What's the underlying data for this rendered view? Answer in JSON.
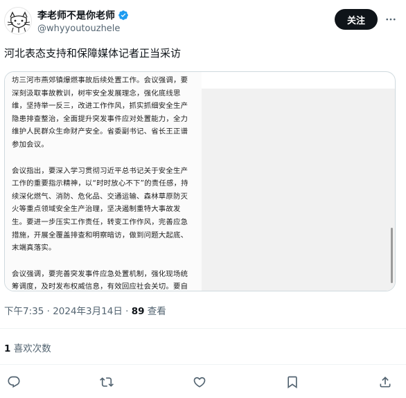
{
  "author": {
    "name": "李老师不是你老师",
    "handle": "@whyyoutouzhele",
    "verified": true,
    "avatar_icon": "doodle-cat-avatar"
  },
  "header": {
    "follow_label": "关注",
    "more_icon": "more-dots-icon"
  },
  "tweet": {
    "text": "河北表态支持和保障媒体记者正当采访",
    "image_paragraphs": [
      "坊三河市燕郊镇爆燃事故后续处置工作。会议强调，要深刻汲取事故教训，树牢安全发展理念，强化底线思维，坚持举一反三，改进工作作风，抓实抓细安全生产隐患排查整治，全面提升突发事件应对处置能力，全力维护人民群众生命财产安全。省委副书记、省长王正谱参加会议。",
      "会议指出，要深入学习贯彻习近平总书记关于安全生产工作的重要指示精神，以“时时放心不下”的责任感，持续深化燃气、消防、危化品、交通运输、森林草原防灭火等重点领域安全生产治理，坚决遏制重特大事故发生。要进一步压实工作责任，转变工作作风，完善应急措施，开展全覆盖排查和明察暗访，做到问题大起底、末端真落实。",
      "会议强调，要完善突发事件应急处置机制，强化现场统筹调度，及时发布权威信息，有效回应社会关切。要自觉接受舆论监督，健全与媒体沟通联系机制，支持和保障媒体记者正当采访。要善于运用媒"
    ]
  },
  "meta": {
    "time": "下午7:35",
    "sep1": " · ",
    "date": "2024年3月14日",
    "sep2": " · ",
    "views_count": "89",
    "views_label": " 查看"
  },
  "stats": {
    "likes_count": "1",
    "likes_label": " 喜欢次数"
  },
  "actions": [
    "reply-icon",
    "retweet-icon",
    "like-icon",
    "bookmark-icon",
    "share-icon"
  ],
  "colors": {
    "text": "#0f1419",
    "secondary": "#536471",
    "verified": "#1d9bf0",
    "button_bg": "#0f1419"
  }
}
